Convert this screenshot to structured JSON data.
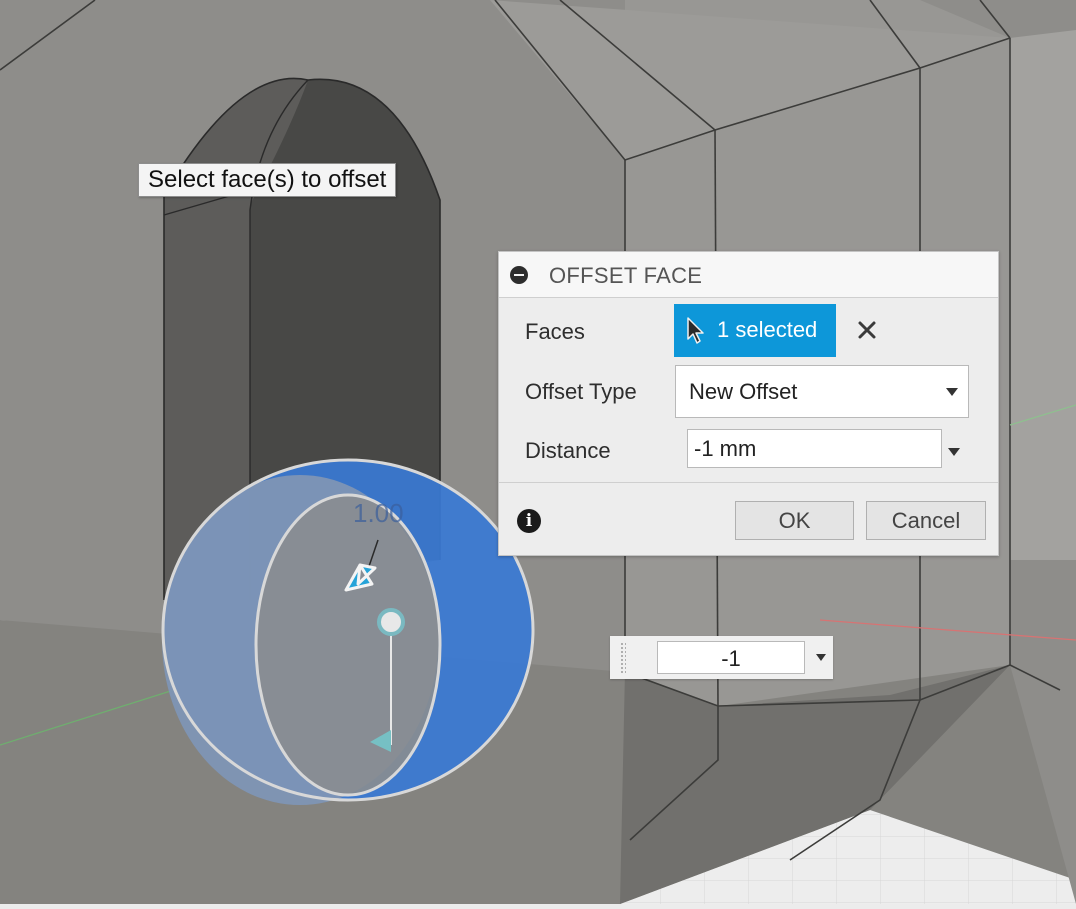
{
  "viewport": {
    "dimension_label": "1.00"
  },
  "tooltip": {
    "text": "Select face(s) to offset"
  },
  "dialog": {
    "title": "OFFSET FACE",
    "faces": {
      "label": "Faces",
      "selection": "1 selected"
    },
    "offset_type": {
      "label": "Offset Type",
      "value": "New Offset"
    },
    "distance": {
      "label": "Distance",
      "value": "-1 mm"
    },
    "ok_label": "OK",
    "cancel_label": "Cancel"
  },
  "inline_input": {
    "value": "-1"
  },
  "colors": {
    "accent": "#0d97d9",
    "selected_face": "#3a79d4",
    "body_gray": "#8e8d8a"
  }
}
